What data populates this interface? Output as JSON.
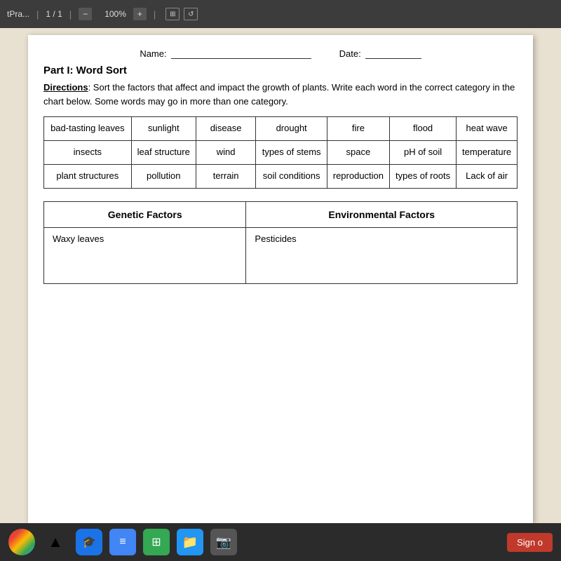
{
  "toolbar": {
    "title": "tPra...",
    "page_current": "1",
    "page_total": "1",
    "zoom": "100%",
    "plus_label": "+",
    "icon1": "⊞",
    "icon2": "↺"
  },
  "document": {
    "name_label": "Name:",
    "date_label": "Date:",
    "part_heading": "Part I: Word Sort",
    "directions_label": "Directions",
    "directions_text": ": Sort the factors that affect and impact the growth of plants. Write each word in the correct category in the chart below. Some words may go in more than one category."
  },
  "word_sort": {
    "rows": [
      [
        "bad-tasting leaves",
        "sunlight",
        "disease",
        "drought",
        "fire",
        "flood",
        "heat wave"
      ],
      [
        "insects",
        "leaf structure",
        "wind",
        "types of stems",
        "space",
        "pH of soil",
        "temperature"
      ],
      [
        "plant structures",
        "pollution",
        "terrain",
        "soil conditions",
        "reproduction",
        "types of roots",
        "Lack of air"
      ]
    ]
  },
  "factors_table": {
    "col1_header": "Genetic Factors",
    "col2_header": "Environmental Factors",
    "col1_content": "Waxy leaves",
    "col2_content": "Pesticides"
  },
  "taskbar": {
    "sign_out": "Sign o"
  }
}
